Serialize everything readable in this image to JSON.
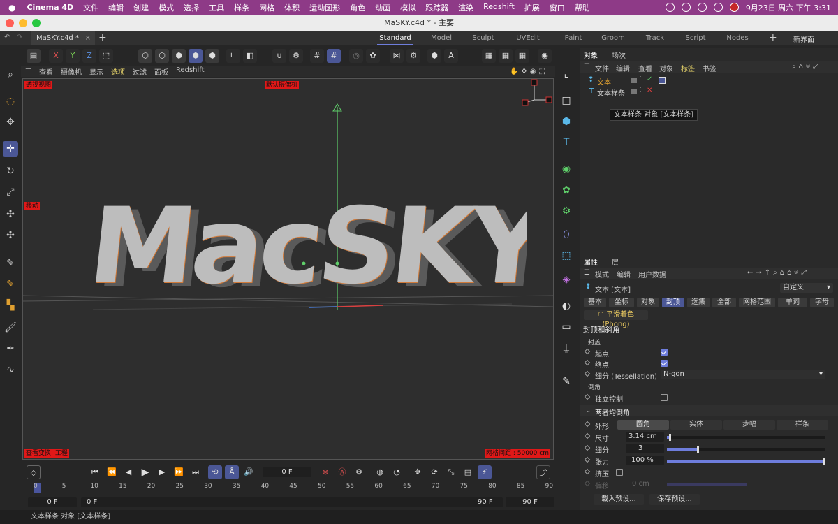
{
  "menubar": {
    "app_name": "Cinema 4D",
    "items": [
      "文件",
      "编辑",
      "创建",
      "模式",
      "选择",
      "工具",
      "样条",
      "网格",
      "体积",
      "运动图形",
      "角色",
      "动画",
      "模拟",
      "跟踪器",
      "渲染",
      "Redshift",
      "扩展",
      "窗口",
      "帮助"
    ],
    "clock": "9月23日 周六 下午 3:31"
  },
  "window": {
    "title": "MaSKY.c4d * - 主要"
  },
  "tabs": {
    "document": "MaSKY.c4d *",
    "layouts": [
      "Standard",
      "Model",
      "Sculpt",
      "UVEdit",
      "Paint",
      "Groom",
      "Track",
      "Script",
      "Nodes"
    ],
    "active_layout": "Standard",
    "new_layout": "新界面"
  },
  "toolbar": {
    "axis_x": "X",
    "axis_y": "Y",
    "axis_z": "Z"
  },
  "viewport_menu": {
    "items": [
      "查看",
      "摄像机",
      "显示",
      "选项",
      "过滤",
      "面板",
      "Redshift"
    ],
    "active": "选项"
  },
  "viewport": {
    "label_perspective": "透视视图",
    "label_camera": "默认摄像机 ",
    "label_move": "移动 ",
    "label_view_transform": "查看变换: 工程",
    "label_grid_spacing": "网格间距 : 50000 cm",
    "text_3d": "MacSKY",
    "colors": {
      "accent": "#e01818",
      "highlight": "#6e7ddc"
    }
  },
  "object_panel": {
    "tabs": [
      "对象",
      "场次"
    ],
    "menu": [
      "文件",
      "编辑",
      "查看",
      "对象",
      "标签",
      "书签"
    ],
    "objects": [
      {
        "name": "文本",
        "icon": "text-spline-icon"
      },
      {
        "name": "文本样条",
        "icon": "text-icon"
      }
    ],
    "tooltip": "文本样条 对象 [文本样条]"
  },
  "attributes": {
    "tabs": [
      "属性",
      "层"
    ],
    "menu": [
      "模式",
      "编辑",
      "用户数据"
    ],
    "object_title": "文本 [文本]",
    "preset_dropdown": "自定义",
    "sub_tabs": [
      "基本",
      "坐标",
      "对象",
      "封顶",
      "选集",
      "全部",
      "网格范围",
      "单词",
      "字母"
    ],
    "active_sub_tab": "封顶",
    "phong": "平滑着色 (Phong)",
    "section_title": "封顶和斜角",
    "group_cap": "封盖",
    "start_label": "起点",
    "end_label": "终点",
    "tessellation_label": "细分 (Tessellation)",
    "tessellation_value": "N-gon",
    "group_bevel": "倒角",
    "independent_label": "独立控制",
    "both_bevel": "两者均倒角",
    "shape_label": "外形",
    "shape_options": [
      "圆角",
      "实体",
      "步幅",
      "样条"
    ],
    "shape_active": "圆角",
    "size_label": "尺寸",
    "size_value": "3.14 cm",
    "size_level": 0.02,
    "subdiv_label": "细分",
    "subdiv_value": "3",
    "subdiv_level": 0.2,
    "tension_label": "张力",
    "tension_value": "100 %",
    "tension_level": 1.0,
    "extrude_label": "挤压",
    "offset_label": "偏移",
    "offset_value": "0 cm",
    "load_preset": "载入预设...",
    "save_preset": "保存预设..."
  },
  "timeline": {
    "current_frame": "0 F",
    "ticks": [
      "0",
      "5",
      "10",
      "15",
      "20",
      "25",
      "30",
      "35",
      "40",
      "45",
      "50",
      "55",
      "60",
      "65",
      "70",
      "75",
      "80",
      "85",
      "90"
    ],
    "range_start": "0 F",
    "range_start2": "0 F",
    "range_end": "90 F",
    "range_end2": "90 F"
  },
  "status_bar": {
    "text": "文本样条 对象 [文本样条]"
  }
}
